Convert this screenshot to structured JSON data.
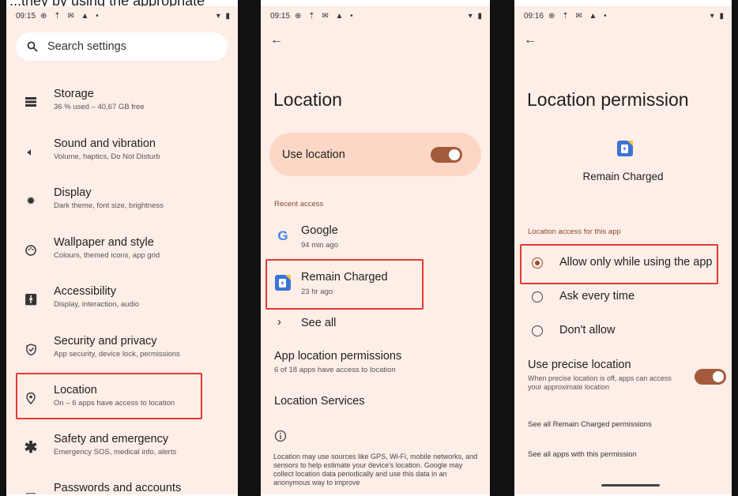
{
  "caption": "...they by using the appropriate",
  "panel1": {
    "status_time": "09:15",
    "search_placeholder": "Search settings",
    "items": [
      {
        "title": "Storage",
        "subtitle": "36 % used – 40,67 GB free",
        "icon": "storage-icon"
      },
      {
        "title": "Sound and vibration",
        "subtitle": "Volume, haptics, Do Not Disturb",
        "icon": "volume-icon"
      },
      {
        "title": "Display",
        "subtitle": "Dark theme, font size, brightness",
        "icon": "brightness-icon"
      },
      {
        "title": "Wallpaper and style",
        "subtitle": "Colours, themed icons, app grid",
        "icon": "palette-icon"
      },
      {
        "title": "Accessibility",
        "subtitle": "Display, interaction, audio",
        "icon": "accessibility-icon"
      },
      {
        "title": "Security and privacy",
        "subtitle": "App security, device lock, permissions",
        "icon": "shield-icon"
      },
      {
        "title": "Location",
        "subtitle": "On – 6 apps have access to location",
        "icon": "location-pin-icon"
      },
      {
        "title": "Safety and emergency",
        "subtitle": "Emergency SOS, medical info, alerts",
        "icon": "asterisk-icon"
      },
      {
        "title": "Passwords and accounts",
        "subtitle": "",
        "icon": "key-icon"
      }
    ]
  },
  "panel2": {
    "status_time": "09:15",
    "title": "Location",
    "use_location_label": "Use location",
    "recent_access_label": "Recent access",
    "apps": [
      {
        "name": "Google",
        "time": "94 min ago"
      },
      {
        "name": "Remain Charged",
        "time": "23 hr ago"
      }
    ],
    "see_all": "See all",
    "app_location_permissions": "App location permissions",
    "app_location_sub": "6 of 18 apps have access to location",
    "location_services": "Location Services",
    "info_text": "Location may use sources like GPS, Wi-Fi, mobile networks, and sensors to help estimate your device's location. Google may collect location data periodically and use this data in an anonymous way to improve"
  },
  "panel3": {
    "status_time": "09:16",
    "title": "Location permission",
    "app_name": "Remain Charged",
    "section_label": "Location access for this app",
    "options": [
      "Allow only while using the app",
      "Ask every time",
      "Don't allow"
    ],
    "selected_index": 0,
    "precise_title": "Use precise location",
    "precise_sub": "When precise location is off, apps can access your approximate location",
    "see_all_app_permissions": "See all Remain Charged permissions",
    "see_all_apps": "See all apps with this permission"
  },
  "colors": {
    "panel_bg": "#fdeee7",
    "accent": "#a45a3c",
    "highlight_box": "#e53935"
  }
}
